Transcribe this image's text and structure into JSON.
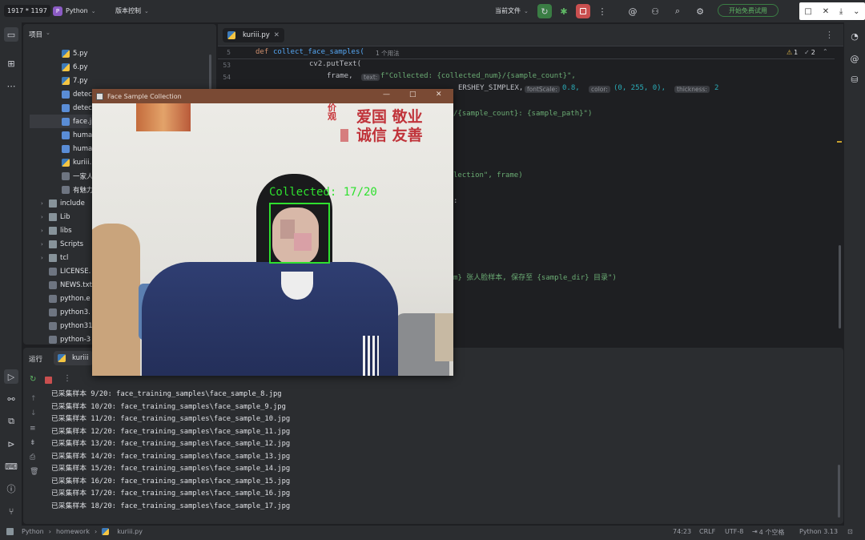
{
  "titlebar": {
    "resolution": "1917 * 1197",
    "project_initial": "P",
    "project_name": "Python",
    "vcs_label": "版本控制",
    "current_file": "当前文件",
    "trial_button": "开始免费试用"
  },
  "project_panel": {
    "title": "项目",
    "items": [
      {
        "label": "5.py",
        "type": "py",
        "indent": 2
      },
      {
        "label": "6.py",
        "type": "py",
        "indent": 2
      },
      {
        "label": "7.py",
        "type": "py",
        "indent": 2
      },
      {
        "label": "detec",
        "type": "img",
        "indent": 2
      },
      {
        "label": "detec",
        "type": "img",
        "indent": 2
      },
      {
        "label": "face.jp",
        "type": "img",
        "indent": 2,
        "selected": true
      },
      {
        "label": "huma",
        "type": "img",
        "indent": 2
      },
      {
        "label": "huma",
        "type": "img",
        "indent": 2
      },
      {
        "label": "kuriii.",
        "type": "py",
        "indent": 2
      },
      {
        "label": "一家人",
        "type": "txt",
        "indent": 2
      },
      {
        "label": "有魅力",
        "type": "txt",
        "indent": 2
      },
      {
        "label": "include",
        "type": "dir",
        "indent": 1,
        "arrow": true
      },
      {
        "label": "Lib",
        "type": "dir",
        "indent": 1,
        "arrow": true
      },
      {
        "label": "libs",
        "type": "dir",
        "indent": 1,
        "arrow": true
      },
      {
        "label": "Scripts",
        "type": "dir",
        "indent": 1,
        "arrow": true
      },
      {
        "label": "tcl",
        "type": "dir",
        "indent": 1,
        "arrow": true
      },
      {
        "label": "LICENSE.",
        "type": "txt",
        "indent": 1
      },
      {
        "label": "NEWS.txt",
        "type": "txt",
        "indent": 1
      },
      {
        "label": "python.e",
        "type": "txt",
        "indent": 1
      },
      {
        "label": "python3.",
        "type": "txt",
        "indent": 1
      },
      {
        "label": "python31",
        "type": "txt",
        "indent": 1
      },
      {
        "label": "python-3",
        "type": "txt",
        "indent": 1
      }
    ]
  },
  "editor": {
    "tab_label": "kuriii.py",
    "breadcrumb_line": "5",
    "breadcrumb_kw": "def",
    "breadcrumb_fn": "collect_face_samples(",
    "usages": "1 个用法",
    "warnings": "1",
    "checks": "2",
    "lines": [
      {
        "num": "53",
        "code": "cv2.putText("
      },
      {
        "num": "54",
        "code": "frame,"
      },
      {
        "num": "",
        "code": "f\"Collected: {collected_num}/{sample_count}\","
      },
      {
        "num": "",
        "code": "ERSHEY_SIMPLEX,"
      },
      {
        "num": "",
        "code": "0.8,"
      },
      {
        "num": "",
        "code": "(0, 255, 0),"
      },
      {
        "num": "",
        "code": "2"
      },
      {
        "num": "",
        "code": "/{sample_count}: {sample_path}\")"
      },
      {
        "num": "",
        "code": "lection\", frame)"
      },
      {
        "num": "",
        "code": ":"
      },
      {
        "num": "",
        "code": "m} 张人脸样本, 保存至 {sample_dir} 目录\")"
      }
    ],
    "hints": {
      "text": "text:",
      "fontscale": "fontScale:",
      "color": "color:",
      "thickness": "thickness:"
    }
  },
  "run_panel": {
    "title": "运行",
    "tab_label": "kuriii",
    "output": [
      "已采集样本 9/20: face_training_samples\\face_sample_8.jpg",
      "已采集样本 10/20: face_training_samples\\face_sample_9.jpg",
      "已采集样本 11/20: face_training_samples\\face_sample_10.jpg",
      "已采集样本 12/20: face_training_samples\\face_sample_11.jpg",
      "已采集样本 13/20: face_training_samples\\face_sample_12.jpg",
      "已采集样本 14/20: face_training_samples\\face_sample_13.jpg",
      "已采集样本 15/20: face_training_samples\\face_sample_14.jpg",
      "已采集样本 16/20: face_training_samples\\face_sample_15.jpg",
      "已采集样本 17/20: face_training_samples\\face_sample_16.jpg",
      "已采集样本 18/20: face_training_samples\\face_sample_17.jpg"
    ]
  },
  "cv_window": {
    "title": "Face Sample Collection",
    "overlay_text": "Collected: 17/20",
    "wall_text_1": "爱国",
    "wall_text_2": "诚信",
    "wall_text_3": "敬业",
    "wall_text_4": "友善",
    "wall_text_5": "价",
    "wall_text_6": "观"
  },
  "status_bar": {
    "crumb_1": "Python",
    "crumb_2": "homework",
    "crumb_3": "kuriii.py",
    "position": "74:23",
    "line_ending": "CRLF",
    "encoding": "UTF-8",
    "indent": "4 个空格",
    "interpreter": "Python 3.13"
  },
  "colors": {
    "accent_green": "#3a7d44",
    "stop_red": "#c94f4f",
    "cv_titlebar": "#7a4a34",
    "overlay_green": "#2fe02f"
  }
}
